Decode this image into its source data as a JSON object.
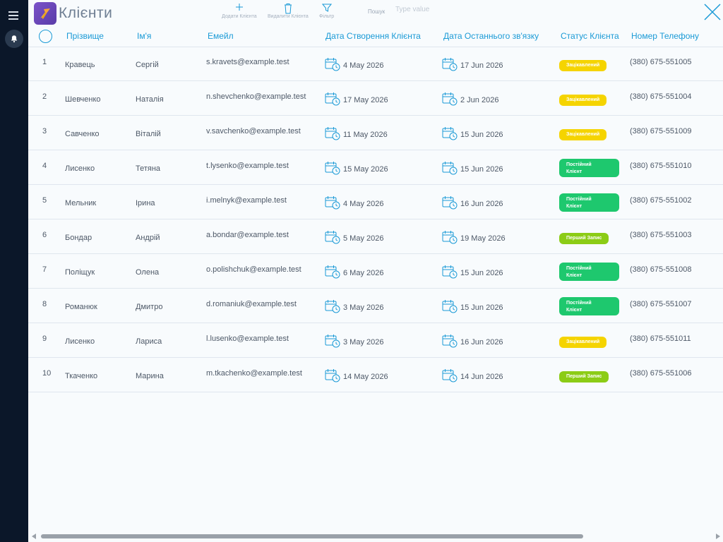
{
  "app": {
    "title": "Клієнти",
    "logo_icon": "logo-icon"
  },
  "sidebar": {
    "menu_icon": "hamburger-icon",
    "notification_icon": "bell-icon"
  },
  "toolbar": {
    "add_label": "Додати Клієнта",
    "delete_label": "Видалити Клієнта",
    "filter_label": "Фільтр",
    "search_label": "Пошук",
    "search_placeholder": "Type value",
    "search_value": ""
  },
  "columns": {
    "last": "Прізвище",
    "first": "Ім'я",
    "email": "Емейл",
    "created": "Дата Створення Клієнта",
    "last_contact": "Дата Останнього зв'язку",
    "status": "Статус Клієнта",
    "phone": "Номер Телефону"
  },
  "status_colors": {
    "Зацікавлений": "#f5d400",
    "Постійний Клієнт": "#1ec86e",
    "Перший Запис": "#8ccc16"
  },
  "rows": [
    {
      "num": "1",
      "last": "Кравець",
      "first": "Сергій",
      "email": "s.kravets@example.test",
      "created": "4 May 2026",
      "last_contact": "17 Jun 2026",
      "status_line1": "Зацікавлений",
      "status_line2": "",
      "status": "Зацікавлений",
      "phone": "(380) 675-551005"
    },
    {
      "num": "2",
      "last": "Шевченко",
      "first": "Наталія",
      "email": "n.shevchenko@example.test",
      "created": "17 May 2026",
      "last_contact": "2 Jun 2026",
      "status_line1": "Зацікавлений",
      "status_line2": "",
      "status": "Зацікавлений",
      "phone": "(380) 675-551004"
    },
    {
      "num": "3",
      "last": "Савченко",
      "first": "Віталій",
      "email": "v.savchenko@example.test",
      "created": "11 May 2026",
      "last_contact": "15 Jun 2026",
      "status_line1": "Зацікавлений",
      "status_line2": "",
      "status": "Зацікавлений",
      "phone": "(380) 675-551009"
    },
    {
      "num": "4",
      "last": "Лисенко",
      "first": "Тетяна",
      "email": "t.lysenko@example.test",
      "created": "15 May 2026",
      "last_contact": "15 Jun 2026",
      "status_line1": "Постійний",
      "status_line2": "Клієнт",
      "status": "Постійний Клієнт",
      "phone": "(380) 675-551010"
    },
    {
      "num": "5",
      "last": "Мельник",
      "first": "Ірина",
      "email": "i.melnyk@example.test",
      "created": "4 May 2026",
      "last_contact": "16 Jun 2026",
      "status_line1": "Постійний",
      "status_line2": "Клієнт",
      "status": "Постійний Клієнт",
      "phone": "(380) 675-551002"
    },
    {
      "num": "6",
      "last": "Бондар",
      "first": "Андрій",
      "email": "a.bondar@example.test",
      "created": "5 May 2026",
      "last_contact": "19 May 2026",
      "status_line1": "Перший Запис",
      "status_line2": "",
      "status": "Перший Запис",
      "phone": "(380) 675-551003"
    },
    {
      "num": "7",
      "last": "Поліщук",
      "first": "Олена",
      "email": "o.polishchuk@example.test",
      "created": "6 May 2026",
      "last_contact": "15 Jun 2026",
      "status_line1": "Постійний",
      "status_line2": "Клієнт",
      "status": "Постійний Клієнт",
      "phone": "(380) 675-551008"
    },
    {
      "num": "8",
      "last": "Романюк",
      "first": "Дмитро",
      "email": "d.romaniuk@example.test",
      "created": "3 May 2026",
      "last_contact": "15 Jun 2026",
      "status_line1": "Постійний",
      "status_line2": "Клієнт",
      "status": "Постійний Клієнт",
      "phone": "(380) 675-551007"
    },
    {
      "num": "9",
      "last": "Лисенко",
      "first": "Лариса",
      "email": "l.lusenko@example.test",
      "created": "3 May 2026",
      "last_contact": "16 Jun 2026",
      "status_line1": "Зацікавлений",
      "status_line2": "",
      "status": "Зацікавлений",
      "phone": "(380) 675-551011"
    },
    {
      "num": "10",
      "last": "Ткаченко",
      "first": "Марина",
      "email": "m.tkachenko@example.test",
      "created": "14 May 2026",
      "last_contact": "14 Jun 2026",
      "status_line1": "Перший Запис",
      "status_line2": "",
      "status": "Перший Запис",
      "phone": "(380) 675-551006"
    }
  ]
}
